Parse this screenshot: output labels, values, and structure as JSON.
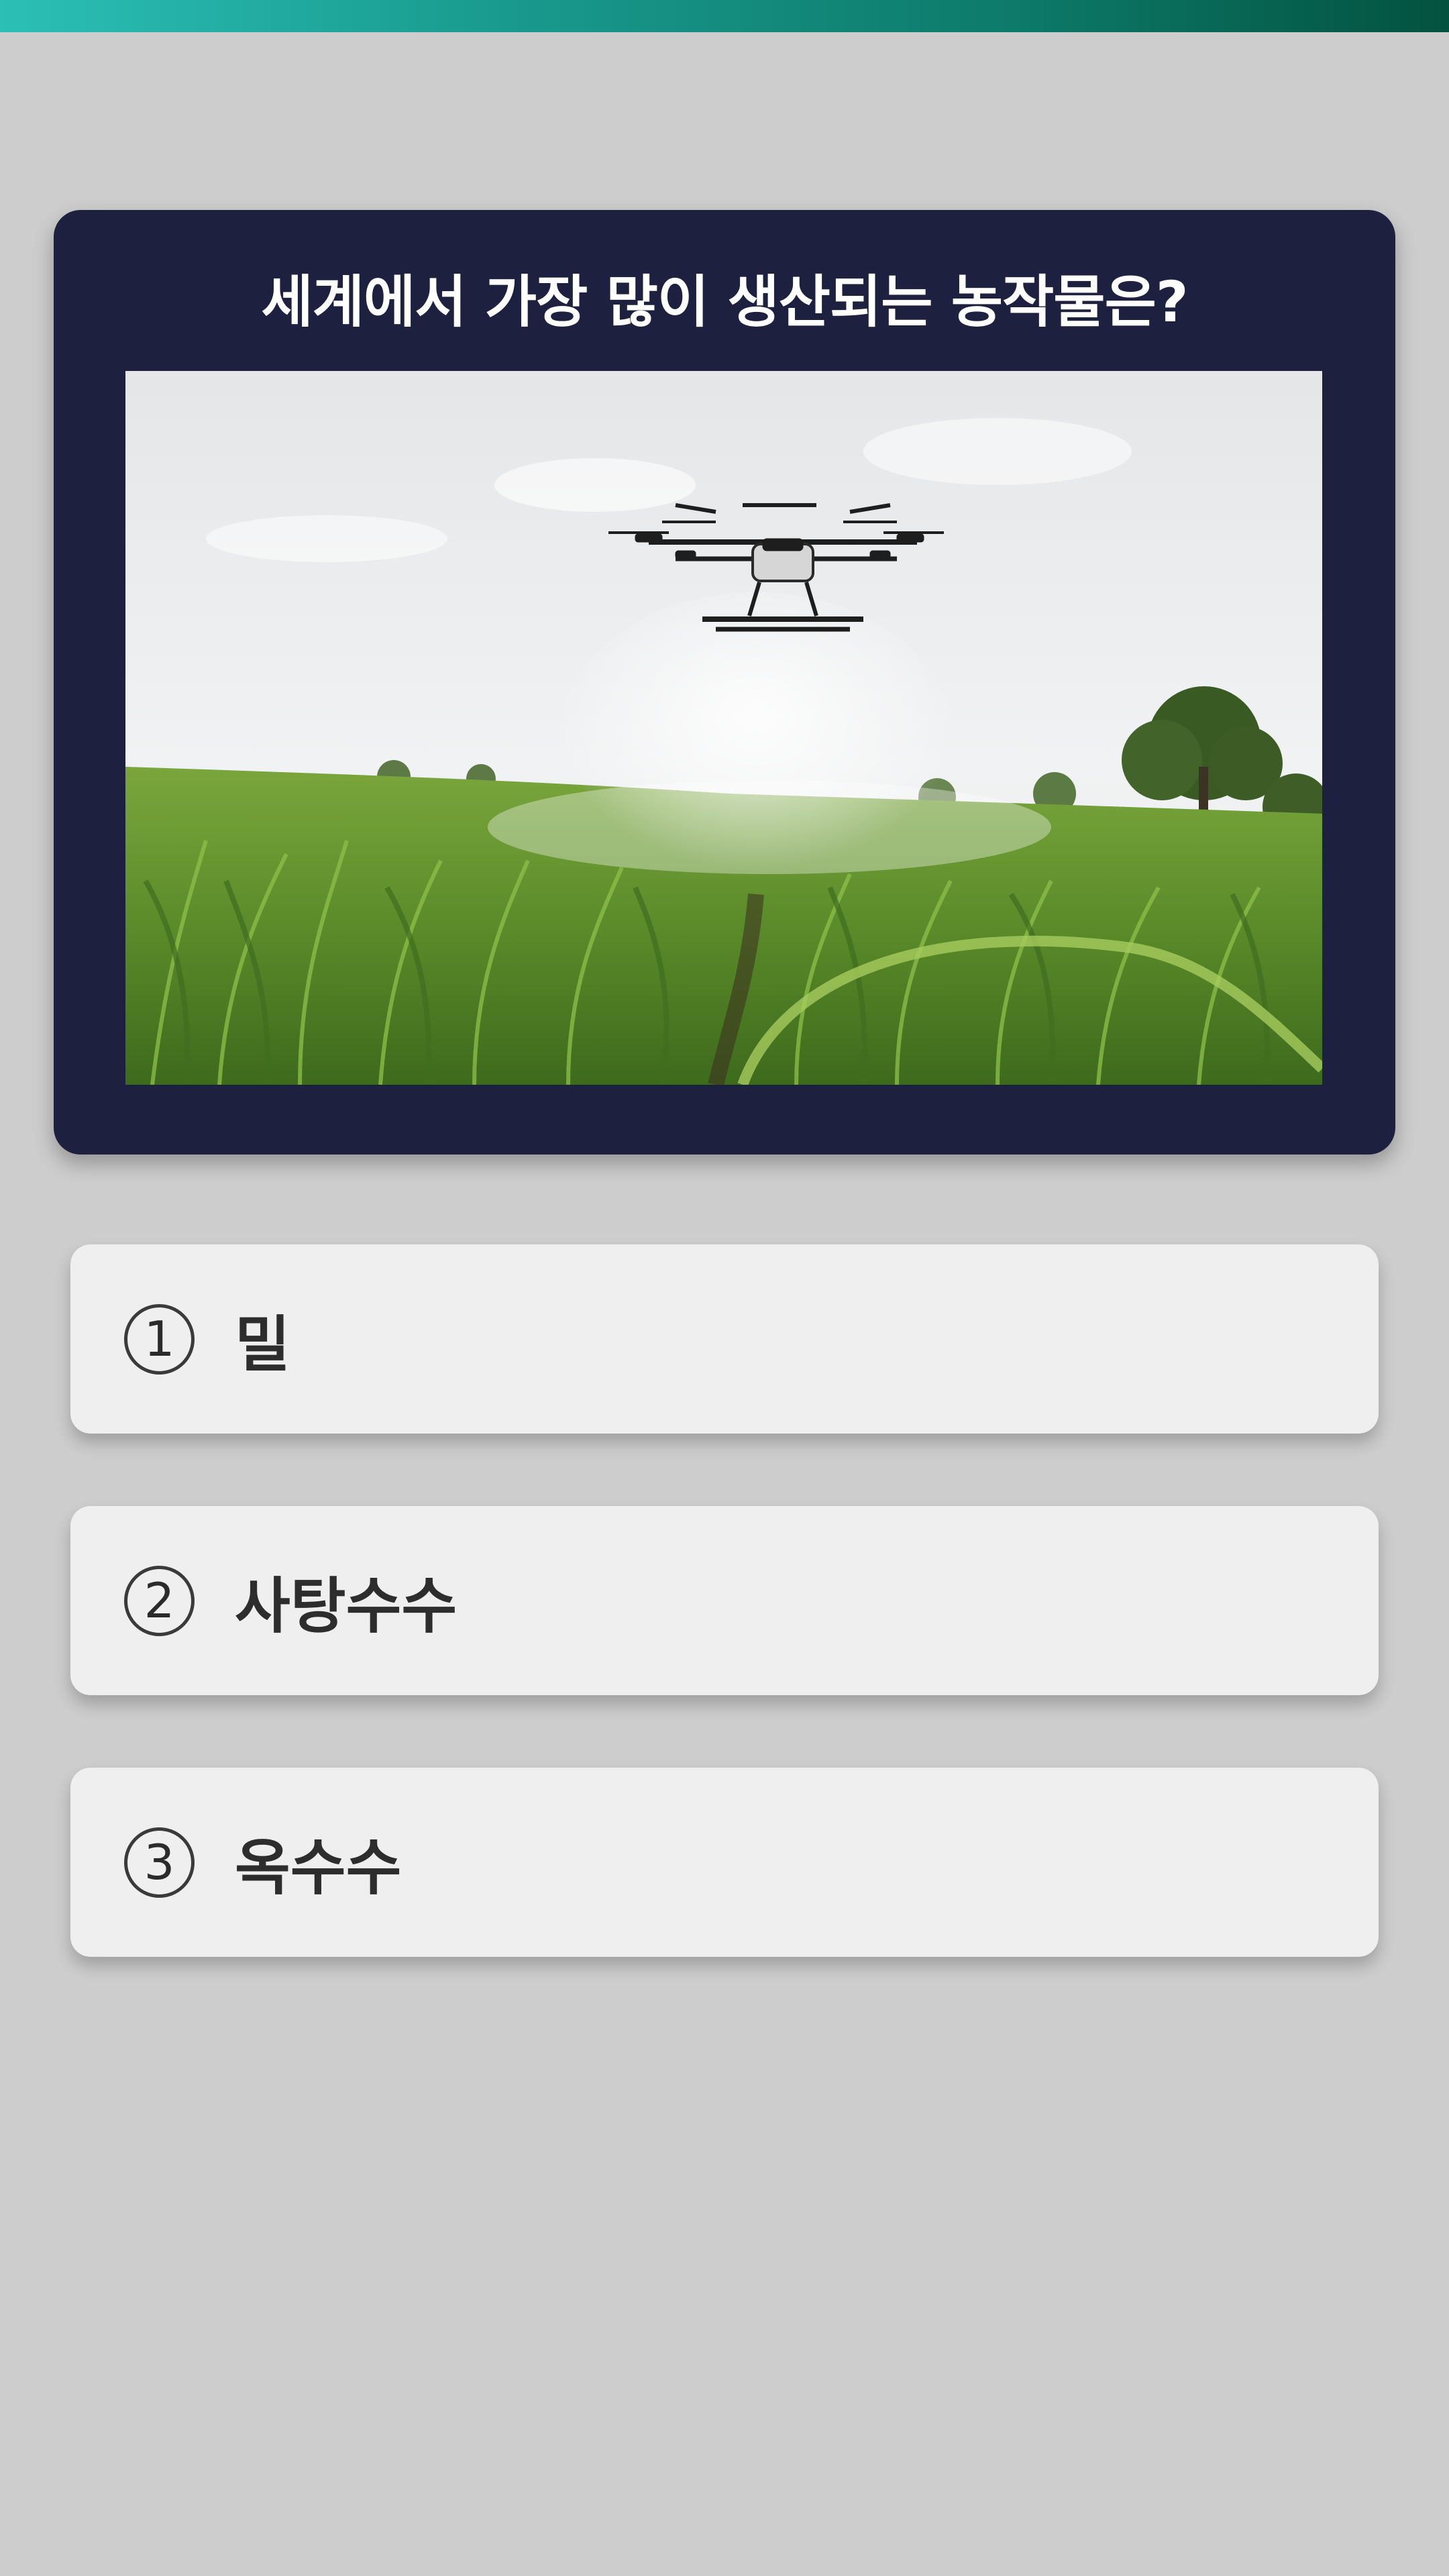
{
  "question": {
    "title": "세계에서 가장 많이 생산되는 농작물은?"
  },
  "answers": [
    {
      "number": "1",
      "label": "밀"
    },
    {
      "number": "2",
      "label": "사탕수수"
    },
    {
      "number": "3",
      "label": "옥수수"
    }
  ],
  "colors": {
    "background": "#cdcdcd",
    "card": "#1e203f",
    "answer_bg": "#efefef",
    "top_bar_start": "#2bbfb6",
    "top_bar_end": "#03523f"
  }
}
